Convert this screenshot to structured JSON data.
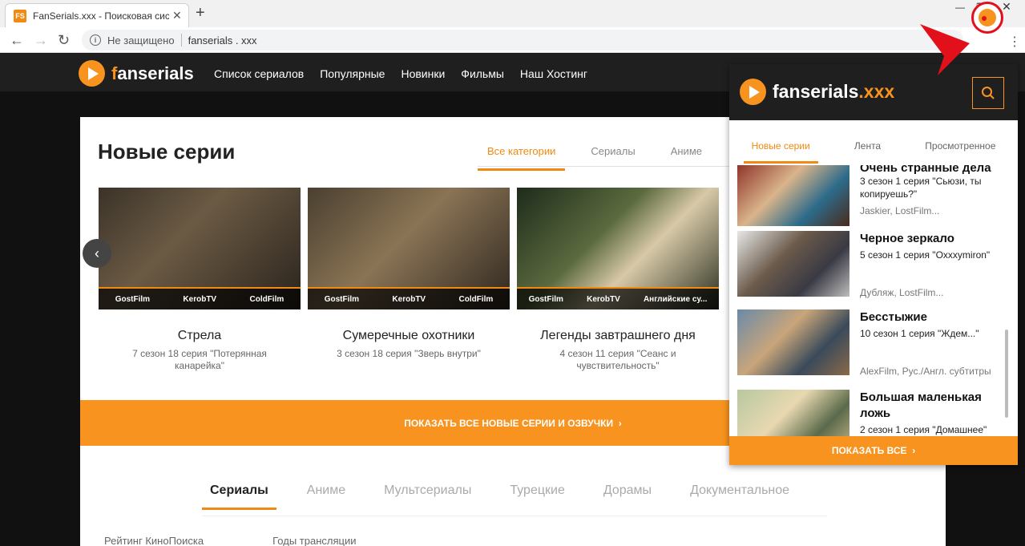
{
  "browser": {
    "tab_title": "FanSerials.xxx - Поисковая сист",
    "favicon": "FS",
    "insecure_label": "Не защищено",
    "url": "fanserials . xxx"
  },
  "site": {
    "logo_f": "f",
    "logo_rest": "anserials",
    "nav": [
      "Список сериалов",
      "Популярные",
      "Новинки",
      "Фильмы",
      "Наш Хостинг"
    ]
  },
  "main": {
    "title": "Новые серии",
    "category_tabs": [
      "Все категории",
      "Сериалы",
      "Аниме"
    ],
    "episodes": [
      {
        "title": "Стрела",
        "sub": "7 сезон 18 серия \"Потерянная канарейка\"",
        "dubs": [
          "GostFilm",
          "KerobTV",
          "ColdFilm"
        ]
      },
      {
        "title": "Сумеречные охотники",
        "sub": "3 сезон 18 серия \"Зверь внутри\"",
        "dubs": [
          "GostFilm",
          "KerobTV",
          "ColdFilm"
        ]
      },
      {
        "title": "Легенды завтрашнего дня",
        "sub": "4 сезон 11 серия \"Сеанс и чувствительность\"",
        "dubs": [
          "GostFilm",
          "KerobTV",
          "Английские су..."
        ]
      }
    ],
    "show_all": "ПОКАЗАТЬ ВСЕ НОВЫЕ СЕРИИ И ОЗВУЧКИ",
    "genre_tabs": [
      "Сериалы",
      "Аниме",
      "Мультсериалы",
      "Турецкие",
      "Дорамы",
      "Документальное"
    ],
    "filters": [
      "Рейтинг КиноПоиска",
      "Годы трансляции"
    ]
  },
  "popup": {
    "logo_main": "fanserials",
    "logo_ext": ".xxx",
    "tabs": [
      "Новые серии",
      "Лента",
      "Просмотренное"
    ],
    "items": [
      {
        "name": "Очень странные дела",
        "ep": "3 сезон 1 серия \"Сьюзи, ты копируешь?\"",
        "dub": "Jaskier, LostFilm..."
      },
      {
        "name": "Черное зеркало",
        "ep": "5 сезон 1 серия \"Oxxxymiron\"",
        "dub": "Дубляж, LostFilm..."
      },
      {
        "name": "Бесстыжие",
        "ep": "10 сезон 1 серия \"Ждем...\"",
        "dub": "AlexFilm, Рус./Англ. субтитры"
      },
      {
        "name": "Большая маленькая ложь",
        "ep": "2 сезон 1 серия \"Домашнее\"",
        "dub": ""
      }
    ],
    "show_all": "ПОКАЗАТЬ ВСЕ"
  },
  "colors": {
    "accent": "#f7931e",
    "alert": "#e2101b"
  }
}
